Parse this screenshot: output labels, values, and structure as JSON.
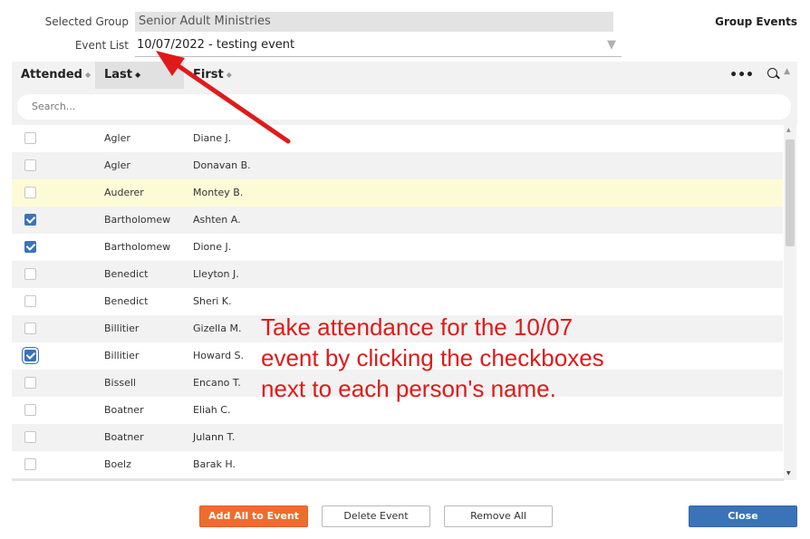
{
  "form": {
    "selected_group_label": "Selected Group",
    "selected_group_value": "Senior Adult Ministries",
    "event_list_label": "Event List",
    "event_list_value": "10/07/2022 - testing event",
    "panel_title": "Group Events"
  },
  "table": {
    "columns": [
      {
        "label": "Attended",
        "sort": "none"
      },
      {
        "label": "Last",
        "sort": "ascending"
      },
      {
        "label": "First",
        "sort": "none"
      }
    ],
    "search_placeholder": "Search...",
    "rows": [
      {
        "attended": false,
        "last": "Agler",
        "first": "Diane J."
      },
      {
        "attended": false,
        "last": "Agler",
        "first": "Donavan B."
      },
      {
        "attended": false,
        "last": "Auderer",
        "first": "Montey B.",
        "highlighted": true
      },
      {
        "attended": true,
        "last": "Bartholomew",
        "first": "Ashten A."
      },
      {
        "attended": true,
        "last": "Bartholomew",
        "first": "Dione J."
      },
      {
        "attended": false,
        "last": "Benedict",
        "first": "Lleyton J."
      },
      {
        "attended": false,
        "last": "Benedict",
        "first": "Sheri K."
      },
      {
        "attended": false,
        "last": "Billitier",
        "first": "Gizella M."
      },
      {
        "attended": true,
        "last": "Billitier",
        "first": "Howard S.",
        "focused": true
      },
      {
        "attended": false,
        "last": "Bissell",
        "first": "Encano T."
      },
      {
        "attended": false,
        "last": "Boatner",
        "first": "Eliah C."
      },
      {
        "attended": false,
        "last": "Boatner",
        "first": "Julann T."
      },
      {
        "attended": false,
        "last": "Boelz",
        "first": "Barak H."
      }
    ]
  },
  "annotation": {
    "lines": [
      "Take attendance for the 10/07",
      "event by clicking the checkboxes",
      "next to each person's name."
    ],
    "color": "#e01a1a"
  },
  "buttons": {
    "add_all": "Add All to Event",
    "delete_event": "Delete Event",
    "remove_all": "Remove All",
    "close": "Close"
  },
  "colors": {
    "accent_blue": "#3b73b9",
    "orange": "#ee6d2e",
    "row_highlight": "#fdfbd6",
    "row_alt": "#f2f2f2"
  }
}
